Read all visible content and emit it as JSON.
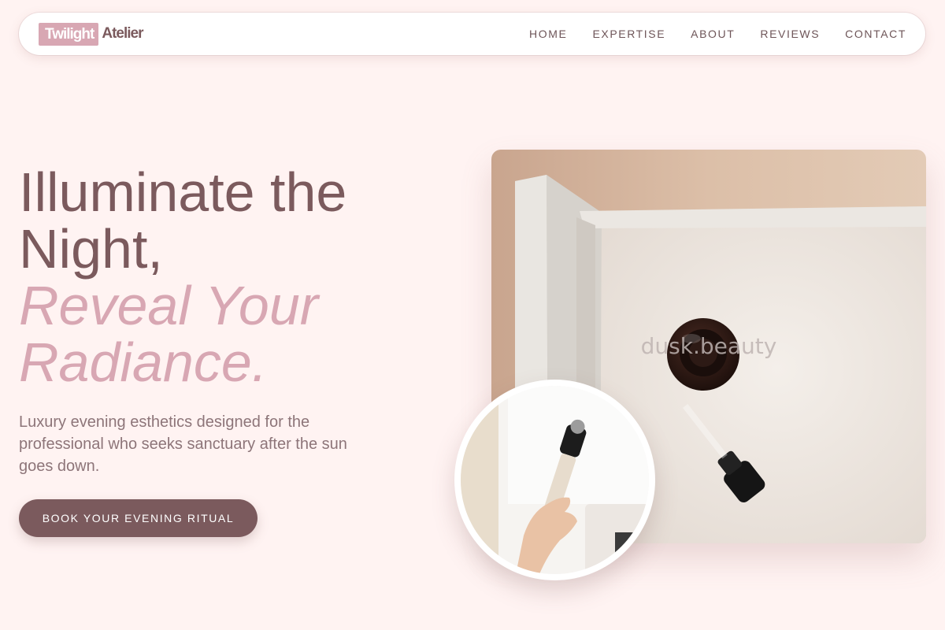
{
  "nav": {
    "logo_mark": "Twilight",
    "logo_text": "Atelier",
    "items": [
      {
        "label": "HOME"
      },
      {
        "label": "EXPERTISE"
      },
      {
        "label": "ABOUT"
      },
      {
        "label": "REVIEWS"
      },
      {
        "label": "CONTACT"
      }
    ]
  },
  "hero": {
    "headline_line1": "Illuminate the",
    "headline_line2": "Night,",
    "headline_accent1": "Reveal Your",
    "headline_accent2": "Radiance.",
    "lead": "Luxury evening esthetics designed for the professional who seeks sanctuary after the sun goes down.",
    "cta_label": "BOOK YOUR EVENING RITUAL"
  },
  "media": {
    "main_photo_watermark": "dusk.beauty"
  },
  "colors": {
    "background": "#fff3f2",
    "primary": "#7b5a5d",
    "accent": "#d8a7b3",
    "text_muted": "#8d7579"
  }
}
